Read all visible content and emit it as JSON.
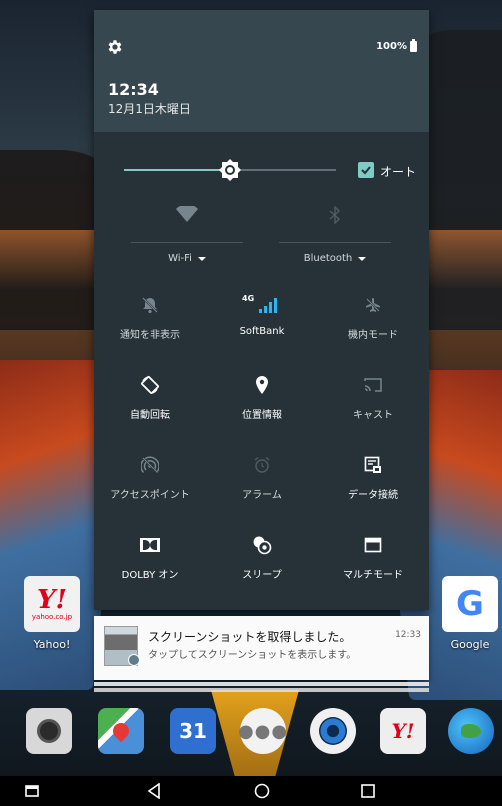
{
  "status": {
    "battery": "100%",
    "time": "12:34",
    "date": "12月1日木曜日"
  },
  "brightness": {
    "level": 0.5,
    "auto_label": "オート",
    "auto_checked": true
  },
  "big_tiles": [
    {
      "label": "Wi-Fi",
      "icon": "wifi-icon"
    },
    {
      "label": "Bluetooth",
      "icon": "bluetooth-icon"
    }
  ],
  "tiles": [
    {
      "label": "通知を非表示",
      "icon": "notifications-off-icon"
    },
    {
      "label": "SoftBank",
      "icon": "cellular-signal-icon",
      "badge": "4G"
    },
    {
      "label": "機内モード",
      "icon": "airplane-icon"
    },
    {
      "label": "自動回転",
      "icon": "auto-rotate-icon"
    },
    {
      "label": "位置情報",
      "icon": "location-icon"
    },
    {
      "label": "キャスト",
      "icon": "cast-icon"
    },
    {
      "label": "アクセスポイント",
      "icon": "hotspot-icon"
    },
    {
      "label": "アラーム",
      "icon": "alarm-icon"
    },
    {
      "label": "データ接続",
      "icon": "data-connection-icon"
    },
    {
      "label": "DOLBY オン",
      "icon": "dolby-icon"
    },
    {
      "label": "スリープ",
      "icon": "sleep-icon"
    },
    {
      "label": "マルチモード",
      "icon": "multi-window-icon"
    }
  ],
  "notification": {
    "title": "スクリーンショットを取得しました。",
    "time": "12:33",
    "text": "タップしてスクリーンショットを表示します。"
  },
  "desktop": {
    "yahoo": {
      "label": "Yahoo!",
      "logo": "Y!",
      "sub": "yahoo.co.jp"
    },
    "google": {
      "label": "Google",
      "logo": "G"
    }
  },
  "dock": {
    "calendar_day": "31",
    "ymail_logo": "Y!"
  },
  "colors": {
    "panel": "#263238",
    "header": "#37474f",
    "accent": "#80cbc4"
  }
}
